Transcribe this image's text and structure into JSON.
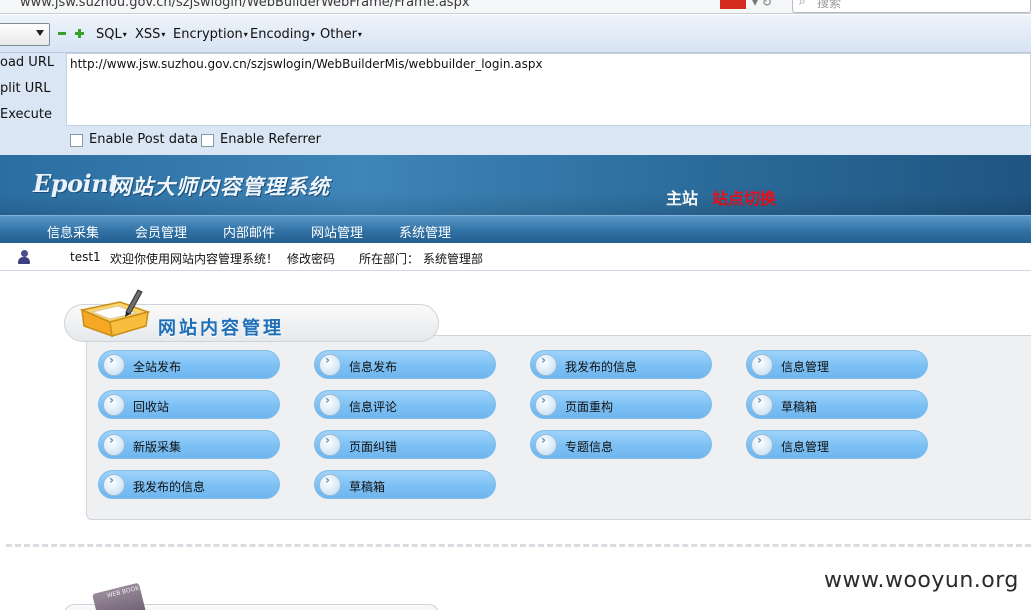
{
  "browser": {
    "address": "www.jsw.suzhou.gov.cn/szjswlogin/WebBuilderWebFrame/Frame.aspx",
    "search_placeholder": "搜索"
  },
  "hackbar": {
    "menus": [
      "SQL",
      "XSS",
      "Encryption",
      "Encoding",
      "Other"
    ],
    "side": {
      "load": "oad URL",
      "split": "plit URL",
      "execute": "Execute"
    },
    "url": "http://www.jsw.suzhou.gov.cn/szjswlogin/WebBuilderMis/webbuilder_login.aspx",
    "enable_post": "Enable Post data",
    "enable_referrer": "Enable Referrer"
  },
  "header": {
    "logo": "Epoint",
    "title": "网站大师内容管理系统",
    "site_main": "主站",
    "site_switch": "站点切换"
  },
  "nav": [
    "信息采集",
    "会员管理",
    "内部邮件",
    "网站管理",
    "系统管理"
  ],
  "userbar": {
    "username": "test1",
    "welcome": "欢迎你使用网站内容管理系统！",
    "change_password": "修改密码",
    "dept_label": "所在部门：",
    "dept": "系统管理部"
  },
  "panel": {
    "title": "网站内容管理",
    "items": [
      "全站发布",
      "信息发布",
      "我发布的信息",
      "信息管理",
      "回收站",
      "信息评论",
      "页面重构",
      "草稿箱",
      "新版采集",
      "页面纠错",
      "专题信息",
      "信息管理",
      "我发布的信息",
      "草稿箱"
    ]
  },
  "second_panel": {
    "book_label": "WEB BOOK"
  },
  "watermark": "www.wooyun.org",
  "colors": {
    "accent": "#1e6fb8",
    "site_switch": "#e8101a",
    "button": "#7cc0f5"
  }
}
